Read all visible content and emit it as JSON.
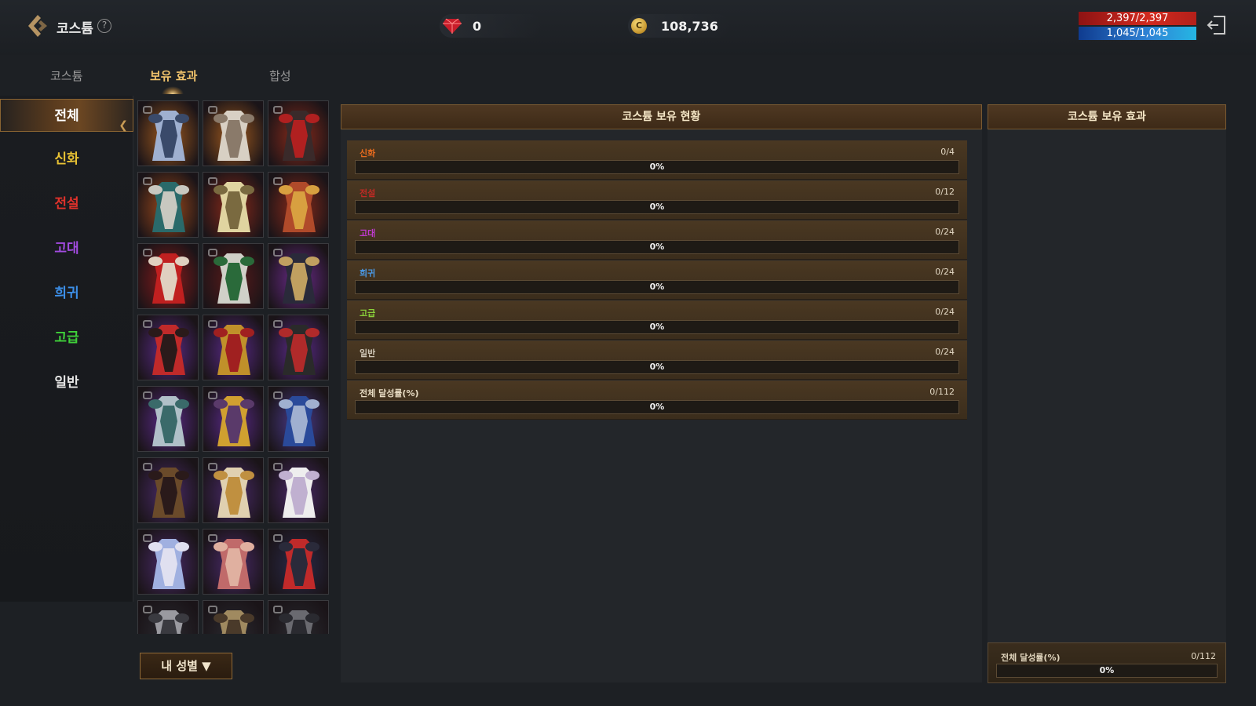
{
  "header": {
    "title": "코스튬",
    "help": "?",
    "gems": "0",
    "gold": "108,736",
    "gold_symbol": "C",
    "hp": "2,397/2,397",
    "mp": "1,045/1,045"
  },
  "tabs": [
    {
      "label": "코스튬",
      "active": false
    },
    {
      "label": "보유 효과",
      "active": true
    },
    {
      "label": "합성",
      "active": false
    }
  ],
  "categories": [
    {
      "label": "전체",
      "color": "#ffffff",
      "active": true
    },
    {
      "label": "신화",
      "color": "#e8c234"
    },
    {
      "label": "전설",
      "color": "#e0322b"
    },
    {
      "label": "고대",
      "color": "#a24be0"
    },
    {
      "label": "희귀",
      "color": "#3c8fe8"
    },
    {
      "label": "고급",
      "color": "#3fd13a"
    },
    {
      "label": "일반",
      "color": "#e6e6e6"
    }
  ],
  "costumes": [
    {
      "icon": "armor-silver-blue-icon",
      "bg": "#a05a1e",
      "c1": "#9fb0d0",
      "c2": "#3a4a6a"
    },
    {
      "icon": "robe-white-icon",
      "bg": "#a05a1e",
      "c1": "#d8d0c4",
      "c2": "#8a7a6a"
    },
    {
      "icon": "armor-dark-red-icon",
      "bg": "#8a2a1a",
      "c1": "#3a2a2a",
      "c2": "#b02020"
    },
    {
      "icon": "armor-teal-icon",
      "bg": "#a04a1a",
      "c1": "#2a6a6a",
      "c2": "#c8c8c0"
    },
    {
      "icon": "armor-gold-winged-icon",
      "bg": "#8a2a1a",
      "c1": "#e0d4a0",
      "c2": "#7a6a40"
    },
    {
      "icon": "armor-red-gold-icon",
      "bg": "#8a2a1a",
      "c1": "#b04a2a",
      "c2": "#d8a040"
    },
    {
      "icon": "armor-crimson-icon",
      "bg": "#8a1a1a",
      "c1": "#c02020",
      "c2": "#e0d0c0"
    },
    {
      "icon": "robe-green-white-icon",
      "bg": "#5a1a1a",
      "c1": "#d0d0c8",
      "c2": "#2a6a3a"
    },
    {
      "icon": "armor-dark-gold-icon",
      "bg": "#6a2a8a",
      "c1": "#2a2a3a",
      "c2": "#c0a060"
    },
    {
      "icon": "dress-red-black-icon",
      "bg": "#5a2a8a",
      "c1": "#c02a2a",
      "c2": "#2a1a1a"
    },
    {
      "icon": "dress-gold-red-icon",
      "bg": "#5a2a8a",
      "c1": "#c0902a",
      "c2": "#a02020"
    },
    {
      "icon": "dress-black-red-icon",
      "bg": "#5a2a8a",
      "c1": "#2a2a2a",
      "c2": "#b02a2a"
    },
    {
      "icon": "armor-silver-teal-icon",
      "bg": "#5a2a8a",
      "c1": "#b0c0c8",
      "c2": "#3a6a6a"
    },
    {
      "icon": "armor-gold-purple-icon",
      "bg": "#5a2a8a",
      "c1": "#d0a030",
      "c2": "#5a3a6a"
    },
    {
      "icon": "armor-blue-icon",
      "bg": "#4a3a8a",
      "c1": "#2a4a9a",
      "c2": "#a0b0d0"
    },
    {
      "icon": "armor-bronze-icon",
      "bg": "#4a2a6a",
      "c1": "#6a4a2a",
      "c2": "#2a1a1a"
    },
    {
      "icon": "dress-white-gold-icon",
      "bg": "#4a2a6a",
      "c1": "#e0d0b0",
      "c2": "#c09040"
    },
    {
      "icon": "dress-white-lace-icon",
      "bg": "#4a2a6a",
      "c1": "#eeeeee",
      "c2": "#c0b0d0"
    },
    {
      "icon": "dress-blue-white-icon",
      "bg": "#4a2a6a",
      "c1": "#a0b0e0",
      "c2": "#e0e0f0"
    },
    {
      "icon": "dress-pink-icon",
      "bg": "#4a2a6a",
      "c1": "#c06a6a",
      "c2": "#e0b0a0"
    },
    {
      "icon": "dress-red-icon",
      "bg": "#2a2a4a",
      "c1": "#c02a2a",
      "c2": "#2a2a3a"
    },
    {
      "icon": "armor-plate-silver-icon",
      "bg": "#2a2a30",
      "c1": "#9a9aa0",
      "c2": "#3a3a40"
    },
    {
      "icon": "armor-plate-gold-icon",
      "bg": "#2a2a30",
      "c1": "#a08a60",
      "c2": "#4a3a2a"
    },
    {
      "icon": "armor-plate-dark-icon",
      "bg": "#2a2a30",
      "c1": "#6a6a70",
      "c2": "#2a2a30"
    }
  ],
  "gender_button": "내 성별 ▼",
  "status_panel": {
    "title": "코스튬 보유 현황",
    "rows": [
      {
        "name": "신화",
        "color": "#e66a1e",
        "count": "0/4",
        "percent": "0%",
        "fill": 0
      },
      {
        "name": "전설",
        "color": "#c02a24",
        "count": "0/12",
        "percent": "0%",
        "fill": 0
      },
      {
        "name": "고대",
        "color": "#c03ad0",
        "count": "0/24",
        "percent": "0%",
        "fill": 0
      },
      {
        "name": "희귀",
        "color": "#4a9ae8",
        "count": "0/24",
        "percent": "0%",
        "fill": 0
      },
      {
        "name": "고급",
        "color": "#8ad03a",
        "count": "0/24",
        "percent": "0%",
        "fill": 0
      },
      {
        "name": "일반",
        "color": "#cfc6b6",
        "count": "0/24",
        "percent": "0%",
        "fill": 0
      },
      {
        "name": "전체 달성률(%)",
        "color": "#e8dcc4",
        "count": "0/112",
        "percent": "0%",
        "fill": 0
      }
    ]
  },
  "effects_panel": {
    "title": "코스튬 보유 효과",
    "total_label": "전체 달성률(%)",
    "total_count": "0/112",
    "total_percent": "0%",
    "total_fill": 0
  }
}
